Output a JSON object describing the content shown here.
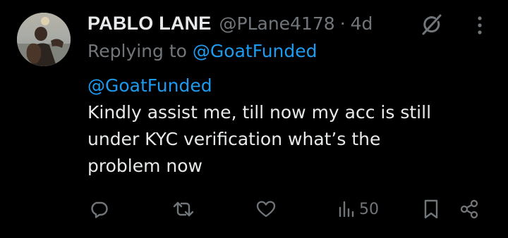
{
  "tweet": {
    "author_name": "PABLO LANE",
    "author_handle": "@PLane4178",
    "separator": "·",
    "timestamp": "4d",
    "replying_prefix": "Replying to",
    "replying_to": "@GoatFunded",
    "body_mention": "@GoatFunded",
    "body_lines": [
      "Kindly assist me, till now my acc is still",
      "under KYC verification what’s the",
      "problem now"
    ]
  },
  "actions": {
    "reply_icon": "reply-icon",
    "retweet_icon": "retweet-icon",
    "like_icon": "heart-icon",
    "views_icon": "views-icon",
    "views_count": "50",
    "bookmark_icon": "bookmark-icon",
    "share_icon": "share-icon"
  },
  "icons": {
    "grok": "grok-icon",
    "more": "more-icon"
  },
  "colors": {
    "background": "#000000",
    "text_primary": "#e7e9ea",
    "text_secondary": "#71767b",
    "accent": "#1d9bf0"
  }
}
